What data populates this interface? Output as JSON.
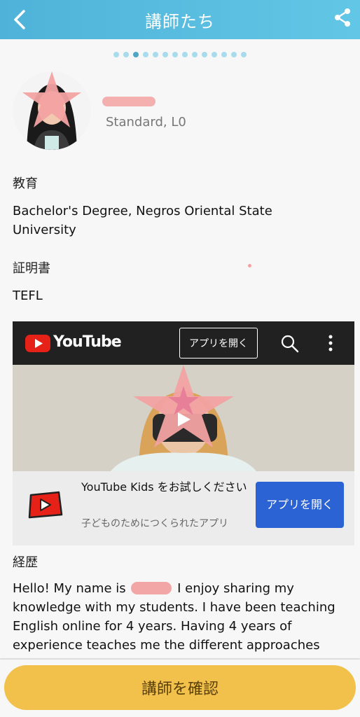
{
  "header": {
    "title": "講師たち",
    "back_icon": "chevron-left-icon",
    "share_icon": "share-icon"
  },
  "pager": {
    "count": 14,
    "active_index": 2
  },
  "profile": {
    "level": "Standard, L0"
  },
  "education": {
    "label": "教育",
    "value": "Bachelor's Degree, Negros Oriental State University"
  },
  "certificate": {
    "label": "証明書",
    "value": "TEFL"
  },
  "youtube": {
    "brand": "YouTube",
    "open_app": "アプリを開く",
    "kids_title": "YouTube Kids をお試しください",
    "kids_subtitle": "子どものためにつくられたアプリ",
    "kids_button": "アプリを開く"
  },
  "history": {
    "label": "経歴",
    "text_before": "Hello! My name is",
    "text_after": "I enjoy sharing my knowledge with my students. I have been teaching English online for 4 years. Having 4 years of experience teaches me the different approaches"
  },
  "cta": {
    "label": "講師を確認"
  },
  "colors": {
    "header": "#55b9de",
    "cta": "#f2c14b",
    "youtube_red": "#e62117",
    "open_button": "#2b63d4"
  }
}
